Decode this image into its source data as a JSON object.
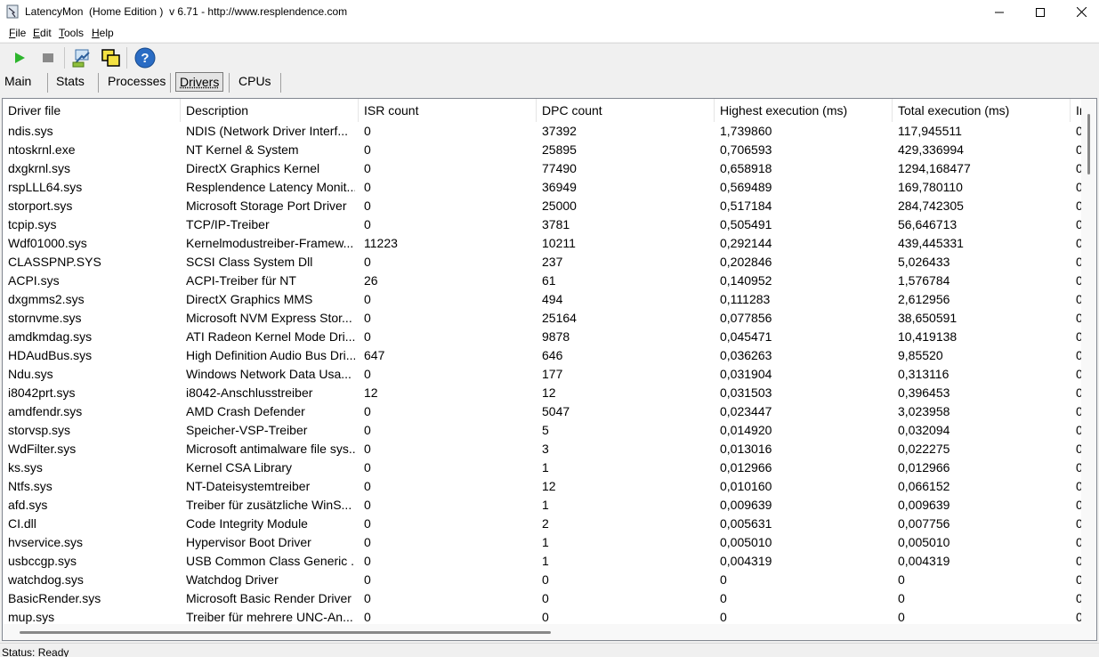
{
  "window": {
    "title": "LatencyMon  (Home Edition )  v 6.71 - http://www.resplendence.com",
    "minimize_label": "",
    "maximize_label": "",
    "close_label": ""
  },
  "menu": [
    {
      "label_u": "F",
      "label_rest": "ile"
    },
    {
      "label_u": "E",
      "label_rest": "dit"
    },
    {
      "label_u": "T",
      "label_rest": "ools"
    },
    {
      "label_u": "H",
      "label_rest": "elp"
    }
  ],
  "toolbar": {
    "icons": [
      "play-icon",
      "stop-icon",
      "submit-icon",
      "windows-icon",
      "help-icon"
    ],
    "colors": {
      "play": "#2db52d",
      "stop": "#8a8a8a",
      "help": "#2a6cc4"
    }
  },
  "tabs": [
    {
      "label": "Main",
      "active": false
    },
    {
      "label": "Stats",
      "active": false
    },
    {
      "label": "Processes",
      "active": false
    },
    {
      "label": "Drivers",
      "active": true
    },
    {
      "label": "CPUs",
      "active": false
    }
  ],
  "table": {
    "columns": [
      "Driver file",
      "Description",
      "ISR count",
      "DPC count",
      "Highest execution (ms)",
      "Total execution (ms)",
      "In"
    ],
    "rows": [
      [
        "ndis.sys",
        "NDIS (Network Driver Interf...",
        "0",
        "37392",
        "1,739860",
        "117,945511",
        "0"
      ],
      [
        "ntoskrnl.exe",
        "NT Kernel & System",
        "0",
        "25895",
        "0,706593",
        "429,336994",
        "0"
      ],
      [
        "dxgkrnl.sys",
        "DirectX Graphics Kernel",
        "0",
        "77490",
        "0,658918",
        "1294,168477",
        "0"
      ],
      [
        "rspLLL64.sys",
        "Resplendence Latency Monit...",
        "0",
        "36949",
        "0,569489",
        "169,780110",
        "0"
      ],
      [
        "storport.sys",
        "Microsoft Storage Port Driver",
        "0",
        "25000",
        "0,517184",
        "284,742305",
        "0"
      ],
      [
        "tcpip.sys",
        "TCP/IP-Treiber",
        "0",
        "3781",
        "0,505491",
        "56,646713",
        "0"
      ],
      [
        "Wdf01000.sys",
        "Kernelmodustreiber-Framew...",
        "11223",
        "10211",
        "0,292144",
        "439,445331",
        "0"
      ],
      [
        "CLASSPNP.SYS",
        "SCSI Class System Dll",
        "0",
        "237",
        "0,202846",
        "5,026433",
        "0"
      ],
      [
        "ACPI.sys",
        "ACPI-Treiber für NT",
        "26",
        "61",
        "0,140952",
        "1,576784",
        "0"
      ],
      [
        "dxgmms2.sys",
        "DirectX Graphics MMS",
        "0",
        "494",
        "0,111283",
        "2,612956",
        "0"
      ],
      [
        "stornvme.sys",
        "Microsoft NVM Express Stor...",
        "0",
        "25164",
        "0,077856",
        "38,650591",
        "0"
      ],
      [
        "amdkmdag.sys",
        "ATI Radeon Kernel Mode Dri...",
        "0",
        "9878",
        "0,045471",
        "10,419138",
        "0"
      ],
      [
        "HDAudBus.sys",
        "High Definition Audio Bus Dri...",
        "647",
        "646",
        "0,036263",
        "9,85520",
        "0"
      ],
      [
        "Ndu.sys",
        "Windows Network Data Usa...",
        "0",
        "177",
        "0,031904",
        "0,313116",
        "0"
      ],
      [
        "i8042prt.sys",
        "i8042-Anschlusstreiber",
        "12",
        "12",
        "0,031503",
        "0,396453",
        "0"
      ],
      [
        "amdfendr.sys",
        "AMD Crash Defender",
        "0",
        "5047",
        "0,023447",
        "3,023958",
        "0"
      ],
      [
        "storvsp.sys",
        "Speicher-VSP-Treiber",
        "0",
        "5",
        "0,014920",
        "0,032094",
        "0"
      ],
      [
        "WdFilter.sys",
        "Microsoft antimalware file sys...",
        "0",
        "3",
        "0,013016",
        "0,022275",
        "0"
      ],
      [
        "ks.sys",
        "Kernel CSA Library",
        "0",
        "1",
        "0,012966",
        "0,012966",
        "0"
      ],
      [
        "Ntfs.sys",
        "NT-Dateisystemtreiber",
        "0",
        "12",
        "0,010160",
        "0,066152",
        "0"
      ],
      [
        "afd.sys",
        "Treiber für zusätzliche WinS...",
        "0",
        "1",
        "0,009639",
        "0,009639",
        "0"
      ],
      [
        "CI.dll",
        "Code Integrity Module",
        "0",
        "2",
        "0,005631",
        "0,007756",
        "0"
      ],
      [
        "hvservice.sys",
        "Hypervisor Boot Driver",
        "0",
        "1",
        "0,005010",
        "0,005010",
        "0"
      ],
      [
        "usbccgp.sys",
        "USB Common Class Generic ...",
        "0",
        "1",
        "0,004319",
        "0,004319",
        "0"
      ],
      [
        "watchdog.sys",
        "Watchdog Driver",
        "0",
        "0",
        "0",
        "0",
        "0"
      ],
      [
        "BasicRender.sys",
        "Microsoft Basic Render Driver",
        "0",
        "0",
        "0",
        "0",
        "0"
      ],
      [
        "mup.sys",
        "Treiber für mehrere UNC-An...",
        "0",
        "0",
        "0",
        "0",
        "0"
      ]
    ]
  },
  "status": {
    "text": "Status: Ready"
  }
}
